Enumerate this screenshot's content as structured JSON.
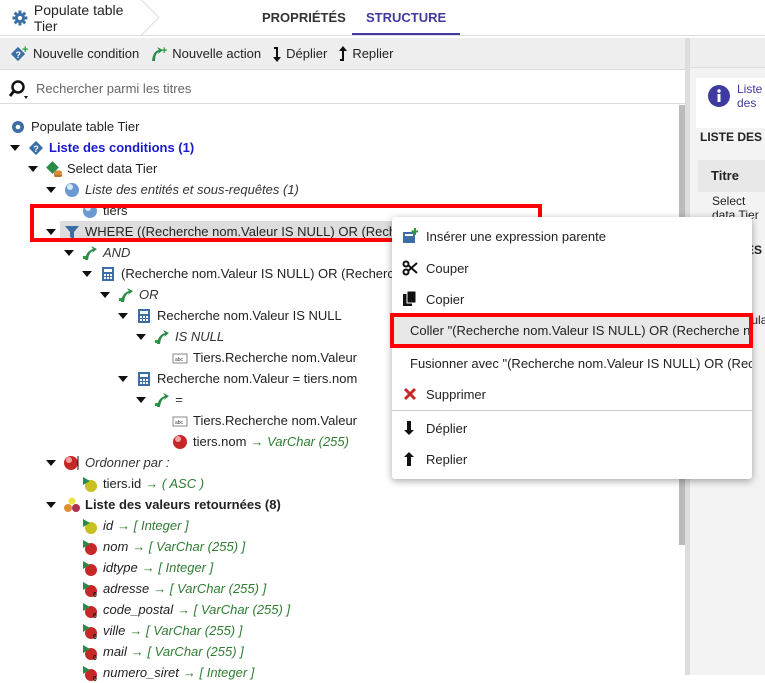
{
  "header": {
    "title": "Populate table Tier",
    "tabs": [
      {
        "label": "PROPRIÉTÉS",
        "active": false
      },
      {
        "label": "STRUCTURE",
        "active": true
      }
    ]
  },
  "toolbar": {
    "new_condition": "Nouvelle condition",
    "new_action": "Nouvelle action",
    "expand": "Déplier",
    "collapse": "Replier"
  },
  "search": {
    "placeholder": "Rechercher parmi les titres",
    "value": ""
  },
  "tree": [
    {
      "level": 0,
      "arrow": false,
      "icon": "gear",
      "text": "Populate table Tier"
    },
    {
      "level": 1,
      "arrow": true,
      "icon": "condition",
      "text": "Liste des conditions (1)",
      "style": "blue-bold"
    },
    {
      "level": 2,
      "arrow": true,
      "icon": "select-data",
      "text": "Select data Tier"
    },
    {
      "level": 3,
      "arrow": true,
      "icon": "blue-sphere",
      "text": "Liste des entités et sous-requêtes (1)",
      "style": "italic"
    },
    {
      "level": 4,
      "arrow": false,
      "icon": "blue-sphere",
      "text": "tiers"
    },
    {
      "level": 3,
      "arrow": true,
      "icon": "filter",
      "text": "WHERE ((Recherche nom.Valeur IS NULL) OR (Recherche nom.Valeur = tiers.nom))",
      "style": "selected"
    },
    {
      "level": 4,
      "arrow": true,
      "icon": "operator",
      "text": "AND",
      "style": "italic"
    },
    {
      "level": 5,
      "arrow": true,
      "icon": "calculator",
      "text": "(Recherche nom.Valeur IS NULL) OR (Recherche nom.Valeur = tiers.nom)"
    },
    {
      "level": 6,
      "arrow": true,
      "icon": "operator",
      "text": "OR",
      "style": "italic"
    },
    {
      "level": 7,
      "arrow": true,
      "icon": "calculator",
      "text": "Recherche nom.Valeur IS NULL"
    },
    {
      "level": 8,
      "arrow": true,
      "icon": "operator",
      "text": "IS NULL",
      "style": "italic"
    },
    {
      "level": 9,
      "arrow": false,
      "icon": "text-field",
      "text": "Tiers.Recherche nom.Valeur"
    },
    {
      "level": 7,
      "arrow": true,
      "icon": "calculator",
      "text": "Recherche nom.Valeur = tiers.nom"
    },
    {
      "level": 8,
      "arrow": true,
      "icon": "operator",
      "text": "=",
      "style": "italic"
    },
    {
      "level": 9,
      "arrow": false,
      "icon": "text-field",
      "text": "Tiers.Recherche nom.Valeur"
    },
    {
      "level": 9,
      "arrow": false,
      "icon": "red-sphere",
      "text": "tiers.nom",
      "suffix": "→ VarChar (255)"
    },
    {
      "level": 3,
      "arrow": true,
      "icon": "sort",
      "text": "Ordonner par :",
      "style": "italic"
    },
    {
      "level": 4,
      "arrow": false,
      "icon": "yellow-sphere-key",
      "text": "tiers.id",
      "suffix": "→ ( ASC )"
    },
    {
      "level": 3,
      "arrow": true,
      "icon": "spheres",
      "text": "Liste des valeurs retournées (8)"
    },
    {
      "level": 4,
      "arrow": false,
      "icon": "yellow-sphere-key",
      "text": "id",
      "suffix": "→ [ Integer ]",
      "style": "italic"
    },
    {
      "level": 4,
      "arrow": false,
      "icon": "red-sphere-field",
      "text": "nom",
      "suffix": "→ [ VarChar (255) ]",
      "style": "italic"
    },
    {
      "level": 4,
      "arrow": false,
      "icon": "red-sphere-field",
      "text": "idtype",
      "suffix": "→ [ Integer ]",
      "style": "italic"
    },
    {
      "level": 4,
      "arrow": false,
      "icon": "red-sphere-nullable",
      "text": "adresse",
      "suffix": "→ [ VarChar (255) ]",
      "style": "italic"
    },
    {
      "level": 4,
      "arrow": false,
      "icon": "red-sphere-nullable",
      "text": "code_postal",
      "suffix": "→ [ VarChar (255) ]",
      "style": "italic"
    },
    {
      "level": 4,
      "arrow": false,
      "icon": "red-sphere-nullable",
      "text": "ville",
      "suffix": "→ [ VarChar (255) ]",
      "style": "italic"
    },
    {
      "level": 4,
      "arrow": false,
      "icon": "red-sphere-nullable",
      "text": "mail",
      "suffix": "→ [ VarChar (255) ]",
      "style": "italic"
    },
    {
      "level": 4,
      "arrow": false,
      "icon": "red-sphere-nullable",
      "text": "numero_siret",
      "suffix": "→ [ Integer ]",
      "style": "italic"
    }
  ],
  "context_menu": [
    {
      "icon": "insert-parent",
      "label": "Insérer une expression parente"
    },
    {
      "icon": "scissors",
      "label": "Couper"
    },
    {
      "icon": "copy",
      "label": "Copier"
    },
    {
      "icon": "paste",
      "label": "Coller \"(Recherche nom.Valeur IS NULL) OR (Recherche nom.Valeur = tiers.nom)\"",
      "highlighted": true
    },
    {
      "icon": "paste",
      "label": "Fusionner avec \"(Recherche nom.Valeur IS NULL) OR (Recherche nom.Valeur = tiers.nom)\""
    },
    {
      "icon": "delete",
      "label": "Supprimer"
    },
    {
      "icon": "expand",
      "label": "Déplier"
    },
    {
      "icon": "collapse",
      "label": "Replier"
    }
  ],
  "right_panel": {
    "info_text": "Liste des conditions de Populate table Tier",
    "section1": "LISTE DES CONDITIONS",
    "col_title": "Titre",
    "cell": "Select data Tier",
    "section2": "LISTE DES ACTIONS",
    "cell2": "Populate"
  },
  "colors": {
    "accent": "#3f3aa0",
    "highlight_box": "#ff0000",
    "link_blue": "#1a1ad0",
    "type_green": "#2e7d32"
  }
}
